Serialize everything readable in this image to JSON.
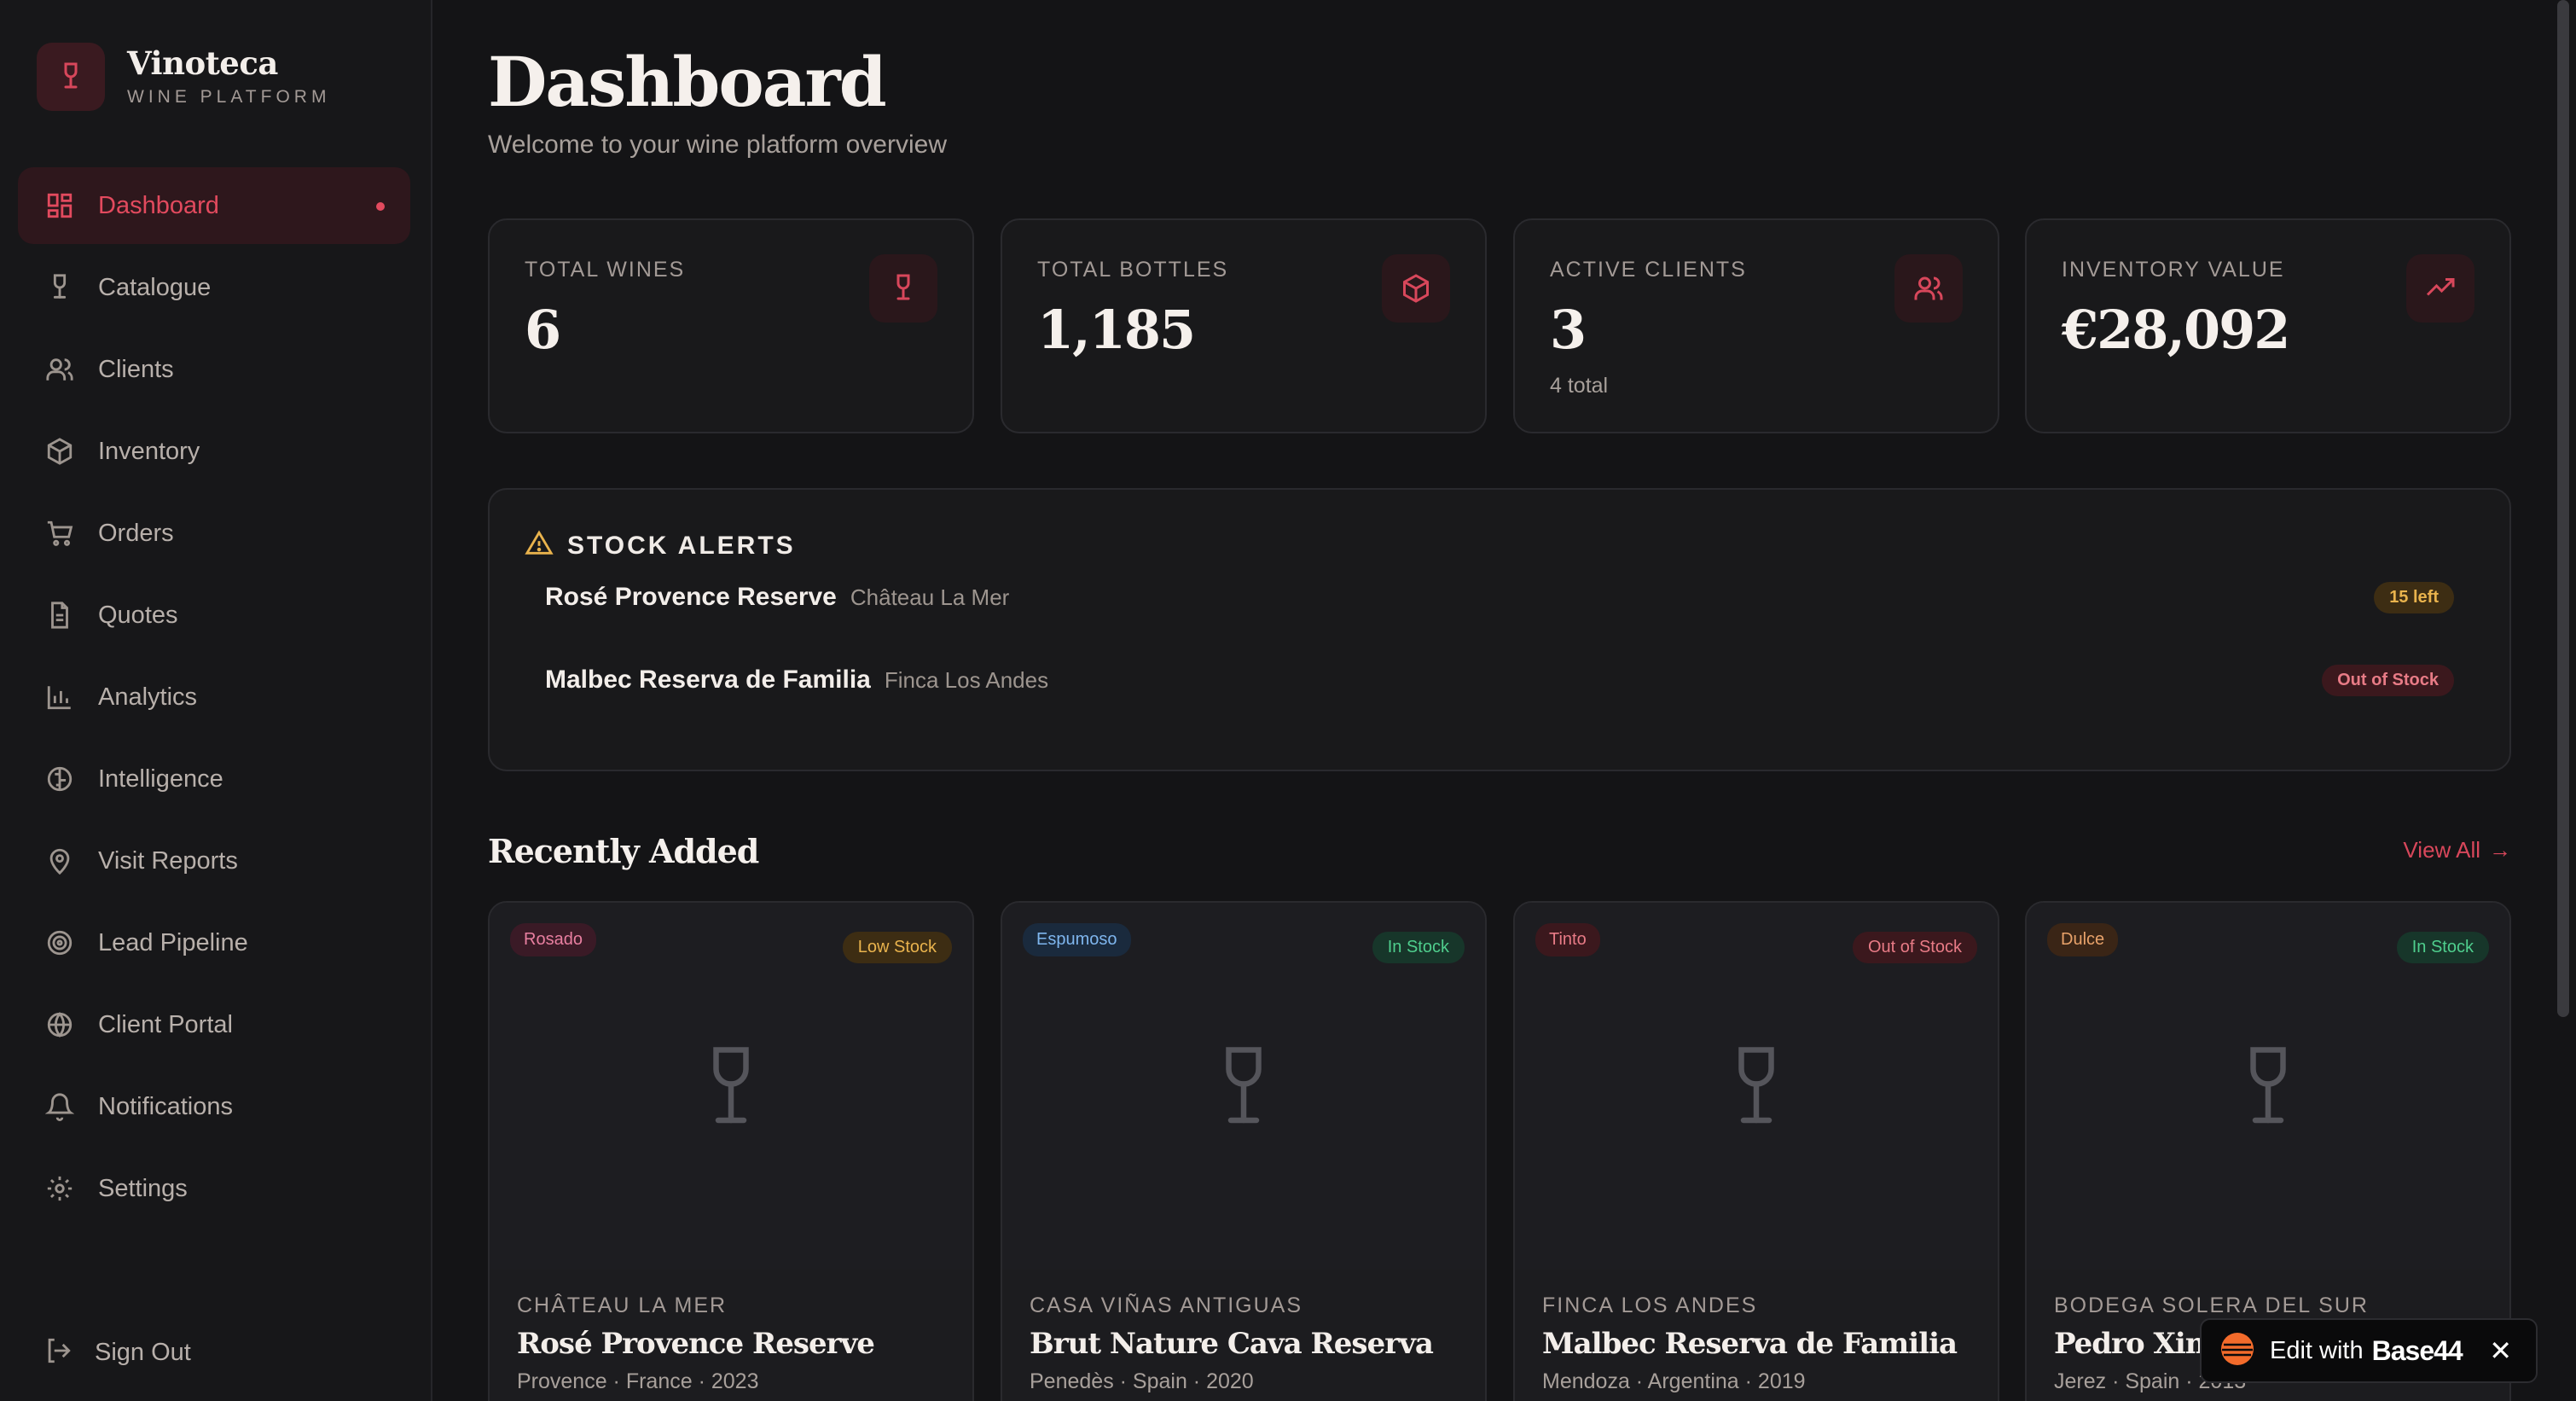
{
  "brand": {
    "name": "Vinoteca",
    "subtitle": "WINE PLATFORM"
  },
  "colors": {
    "accent": "#e24a5e",
    "background": "#141416",
    "card": "#19191b"
  },
  "nav": [
    {
      "label": "Dashboard",
      "icon": "dashboard-icon",
      "active": true
    },
    {
      "label": "Catalogue",
      "icon": "wine-glass-icon"
    },
    {
      "label": "Clients",
      "icon": "users-icon"
    },
    {
      "label": "Inventory",
      "icon": "package-icon"
    },
    {
      "label": "Orders",
      "icon": "cart-icon"
    },
    {
      "label": "Quotes",
      "icon": "document-icon"
    },
    {
      "label": "Analytics",
      "icon": "bar-chart-icon"
    },
    {
      "label": "Intelligence",
      "icon": "brain-icon"
    },
    {
      "label": "Visit Reports",
      "icon": "map-pin-icon"
    },
    {
      "label": "Lead Pipeline",
      "icon": "target-icon"
    },
    {
      "label": "Client Portal",
      "icon": "globe-icon"
    },
    {
      "label": "Notifications",
      "icon": "bell-icon"
    },
    {
      "label": "Settings",
      "icon": "gear-icon"
    }
  ],
  "signout": {
    "label": "Sign Out",
    "icon": "logout-icon"
  },
  "page": {
    "title": "Dashboard",
    "subtitle": "Welcome to your wine platform overview"
  },
  "stats": [
    {
      "label": "TOTAL WINES",
      "value": "6",
      "note": "",
      "icon": "wine-glass-icon"
    },
    {
      "label": "TOTAL BOTTLES",
      "value": "1,185",
      "note": "",
      "icon": "package-icon"
    },
    {
      "label": "ACTIVE CLIENTS",
      "value": "3",
      "note": "4 total",
      "icon": "users-icon"
    },
    {
      "label": "INVENTORY VALUE",
      "value": "€28,092",
      "note": "",
      "icon": "trending-up-icon"
    }
  ],
  "alerts": {
    "title": "STOCK ALERTS",
    "items": [
      {
        "name": "Rosé Provence Reserve",
        "producer": "Château La Mer",
        "badge": "15 left",
        "level": "low"
      },
      {
        "name": "Malbec Reserva de Familia",
        "producer": "Finca Los Andes",
        "badge": "Out of Stock",
        "level": "out"
      }
    ]
  },
  "recent": {
    "title": "Recently Added",
    "view_all": "View All",
    "wines": [
      {
        "type": "Rosado",
        "type_color": "#e87fa0",
        "type_bg": "#3a1a26",
        "stock": "Low Stock",
        "stock_level": "low",
        "producer": "CHÂTEAU LA MER",
        "name": "Rosé Provence Reserve",
        "meta": "Provence · France · 2023"
      },
      {
        "type": "Espumoso",
        "type_color": "#7fb6ee",
        "type_bg": "#1a2a3d",
        "stock": "In Stock",
        "stock_level": "in",
        "producer": "CASA VIÑAS ANTIGUAS",
        "name": "Brut Nature Cava Reserva",
        "meta": "Penedès · Spain · 2020"
      },
      {
        "type": "Tinto",
        "type_color": "#e87b86",
        "type_bg": "#3b181d",
        "stock": "Out of Stock",
        "stock_level": "out",
        "producer": "FINCA LOS ANDES",
        "name": "Malbec Reserva de Familia",
        "meta": "Mendoza · Argentina · 2019"
      },
      {
        "type": "Dulce",
        "type_color": "#e8a26a",
        "type_bg": "#3a2516",
        "stock": "In Stock",
        "stock_level": "in",
        "producer": "BODEGA SOLERA DEL SUR",
        "name": "Pedro Ximé",
        "meta": "Jerez · Spain · 2013"
      }
    ]
  },
  "edit_badge": {
    "label": "Edit with",
    "brand": "Base44",
    "close": "✕"
  }
}
